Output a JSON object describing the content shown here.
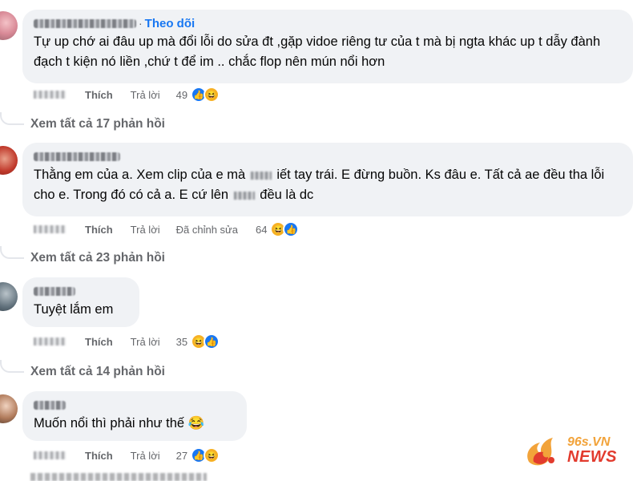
{
  "comments": [
    {
      "follow_label": "Theo dõi",
      "text": "Tự up chớ ai đâu up mà đổi lỗi do sửa đt ,gặp vidoe riêng tư của t mà bị ngta khác up t dẫy đành đạch t kiện nó liền ,chứ t để im .. chắc flop nên mún nổi hơn",
      "like_label": "Thích",
      "reply_label": "Trả lời",
      "reaction_count": "49",
      "reactions": [
        "like-icon",
        "haha-icon"
      ],
      "view_replies": "Xem tất cả 17 phản hồi"
    },
    {
      "text_part1": "Thằng em của a. Xem clip của e mà",
      "text_part2": "iết tay trái. E đừng buồn. Ks đâu e. Tất cả ae đều tha lỗi cho e. Trong đó có cả a. E cứ lên",
      "text_part3": "đều là dc",
      "like_label": "Thích",
      "reply_label": "Trả lời",
      "edited_label": "Đã chỉnh sửa",
      "reaction_count": "64",
      "reactions": [
        "haha-icon",
        "like-icon"
      ],
      "view_replies": "Xem tất cả 23 phản hồi"
    },
    {
      "text": "Tuyệt lắm em",
      "like_label": "Thích",
      "reply_label": "Trả lời",
      "reaction_count": "35",
      "reactions": [
        "haha-icon",
        "like-icon"
      ],
      "view_replies": "Xem tất cả 14 phản hồi"
    },
    {
      "text": "Muốn nổi thì phải như thế 😂",
      "like_label": "Thích",
      "reply_label": "Trả lời",
      "reaction_count": "27",
      "reactions": [
        "like-icon",
        "haha-icon"
      ]
    }
  ],
  "watermark": {
    "top": "96s.VN",
    "bottom": "NEWS"
  },
  "colors": {
    "bubble": "#f0f2f5",
    "link_blue": "#1877f2",
    "muted": "#65676b",
    "watermark_orange": "#f2a33a",
    "watermark_red": "#e23b2e"
  }
}
